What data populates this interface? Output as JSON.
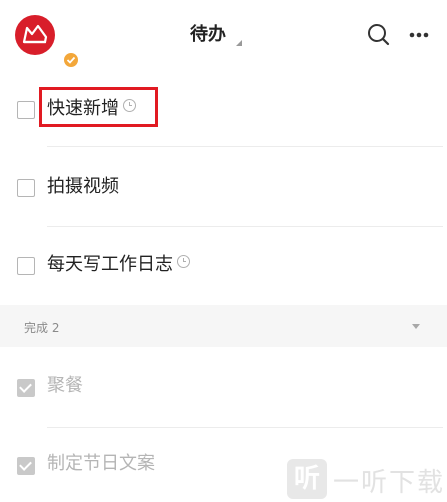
{
  "header": {
    "title": "待办",
    "avatar_icon": "fox-logo-icon",
    "badge_icon": "vip-badge-icon",
    "search_icon": "search-icon",
    "more_icon": "more-icon"
  },
  "todos": [
    {
      "label": "快速新增",
      "checked": false,
      "has_reminder": true
    },
    {
      "label": "拍摄视频",
      "checked": false,
      "has_reminder": false
    },
    {
      "label": "每天写工作日志",
      "checked": false,
      "has_reminder": true
    }
  ],
  "done_section": {
    "label": "完成 2"
  },
  "done_items": [
    {
      "label": "聚餐",
      "checked": true
    },
    {
      "label": "制定节日文案",
      "checked": true
    }
  ],
  "watermark": {
    "glyph": "听",
    "text": "一听下载"
  },
  "colors": {
    "brand_red": "#d81e2a",
    "highlight": "#e11a22",
    "badge": "#f3a73a"
  }
}
